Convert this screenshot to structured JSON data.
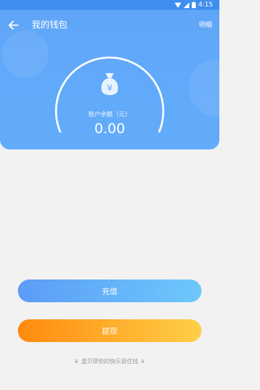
{
  "status_bar": {
    "time": "4:15"
  },
  "header": {
    "back_icon": "arrow-left-icon",
    "title": "我的钱包",
    "details_label": "明细"
  },
  "balance": {
    "icon": "money-bag-icon",
    "label": "账户余额（元）",
    "value": "0.00"
  },
  "actions": {
    "recharge_label": "充值",
    "withdraw_label": "提现"
  },
  "footer": {
    "slogan": "虚贝帮你的快乐管住钱"
  },
  "colors": {
    "header_bg": "#5fa6f8",
    "recharge_gradient": [
      "#5b9cf7",
      "#6ec8fb"
    ],
    "withdraw_gradient": [
      "#ff8a10",
      "#ffcf47"
    ]
  }
}
